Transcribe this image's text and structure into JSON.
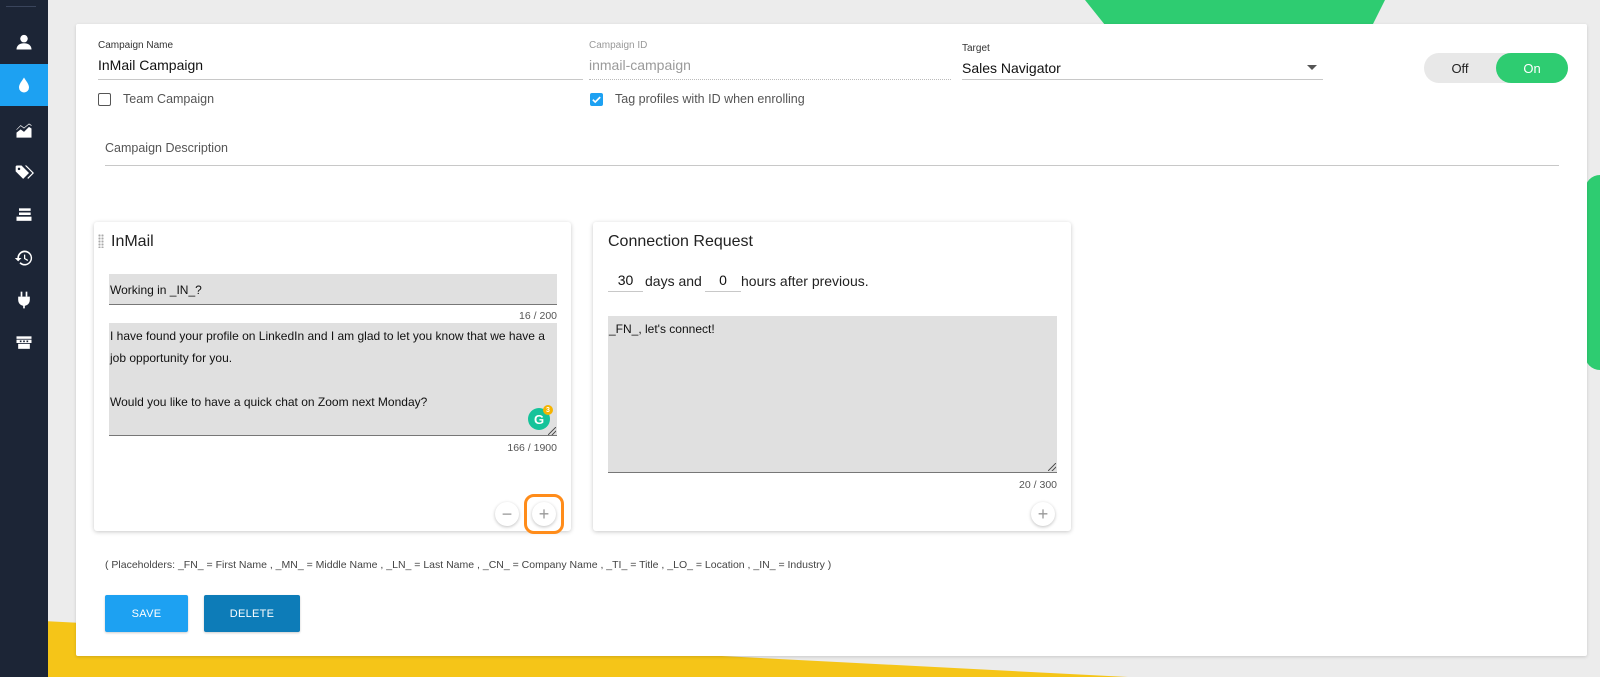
{
  "campaign": {
    "name_label": "Campaign Name",
    "name_value": "InMail Campaign",
    "id_label": "Campaign ID",
    "id_value": "inmail-campaign",
    "target_label": "Target",
    "target_value": "Sales Navigator",
    "team_campaign_label": "Team Campaign",
    "team_campaign_checked": false,
    "tag_profiles_label": "Tag profiles with ID when enrolling",
    "tag_profiles_checked": true,
    "description_label": "Campaign Description"
  },
  "toggle": {
    "off_label": "Off",
    "on_label": "On",
    "state": "On"
  },
  "sidebar": {
    "items": [
      {
        "icon": "person-icon",
        "active": false
      },
      {
        "icon": "drop-icon",
        "active": true
      },
      {
        "icon": "area-chart-icon",
        "active": false
      },
      {
        "icon": "tags-icon",
        "active": false
      },
      {
        "icon": "list-icon",
        "active": false
      },
      {
        "icon": "history-icon",
        "active": false
      },
      {
        "icon": "plug-icon",
        "active": false
      },
      {
        "icon": "storefront-icon",
        "active": false
      }
    ]
  },
  "steps": {
    "inmail": {
      "title": "InMail",
      "subject": "Working in _IN_?",
      "subject_counter": "16 / 200",
      "body": "I have found your profile on LinkedIn and I am glad to let you know that we have a job opportunity for you.\n\nWould you like to have a quick chat on Zoom next Monday?",
      "body_counter": "166 / 1900",
      "grammarly_letter": "G",
      "grammarly_count": "3",
      "remove_symbol": "−",
      "add_symbol": "+"
    },
    "connection": {
      "title": "Connection Request",
      "days_value": "30",
      "days_text": "days and",
      "hours_value": "0",
      "hours_text": "hours after previous.",
      "message": "_FN_, let's connect!",
      "message_counter": "20 / 300",
      "add_symbol": "+"
    }
  },
  "placeholders_text": "( Placeholders: _FN_ = First Name , _MN_ = Middle Name , _LN_ = Last Name , _CN_ = Company Name , _TI_ = Title , _LO_ = Location , _IN_ = Industry )",
  "buttons": {
    "save": "SAVE",
    "delete": "DELETE"
  },
  "colors": {
    "primary": "#1da1f2",
    "dark_blue": "#0d7cb8",
    "green": "#2ecc71",
    "sidebar": "#1c2536",
    "highlight": "#ff8c1a",
    "yellow": "#f5c518"
  }
}
